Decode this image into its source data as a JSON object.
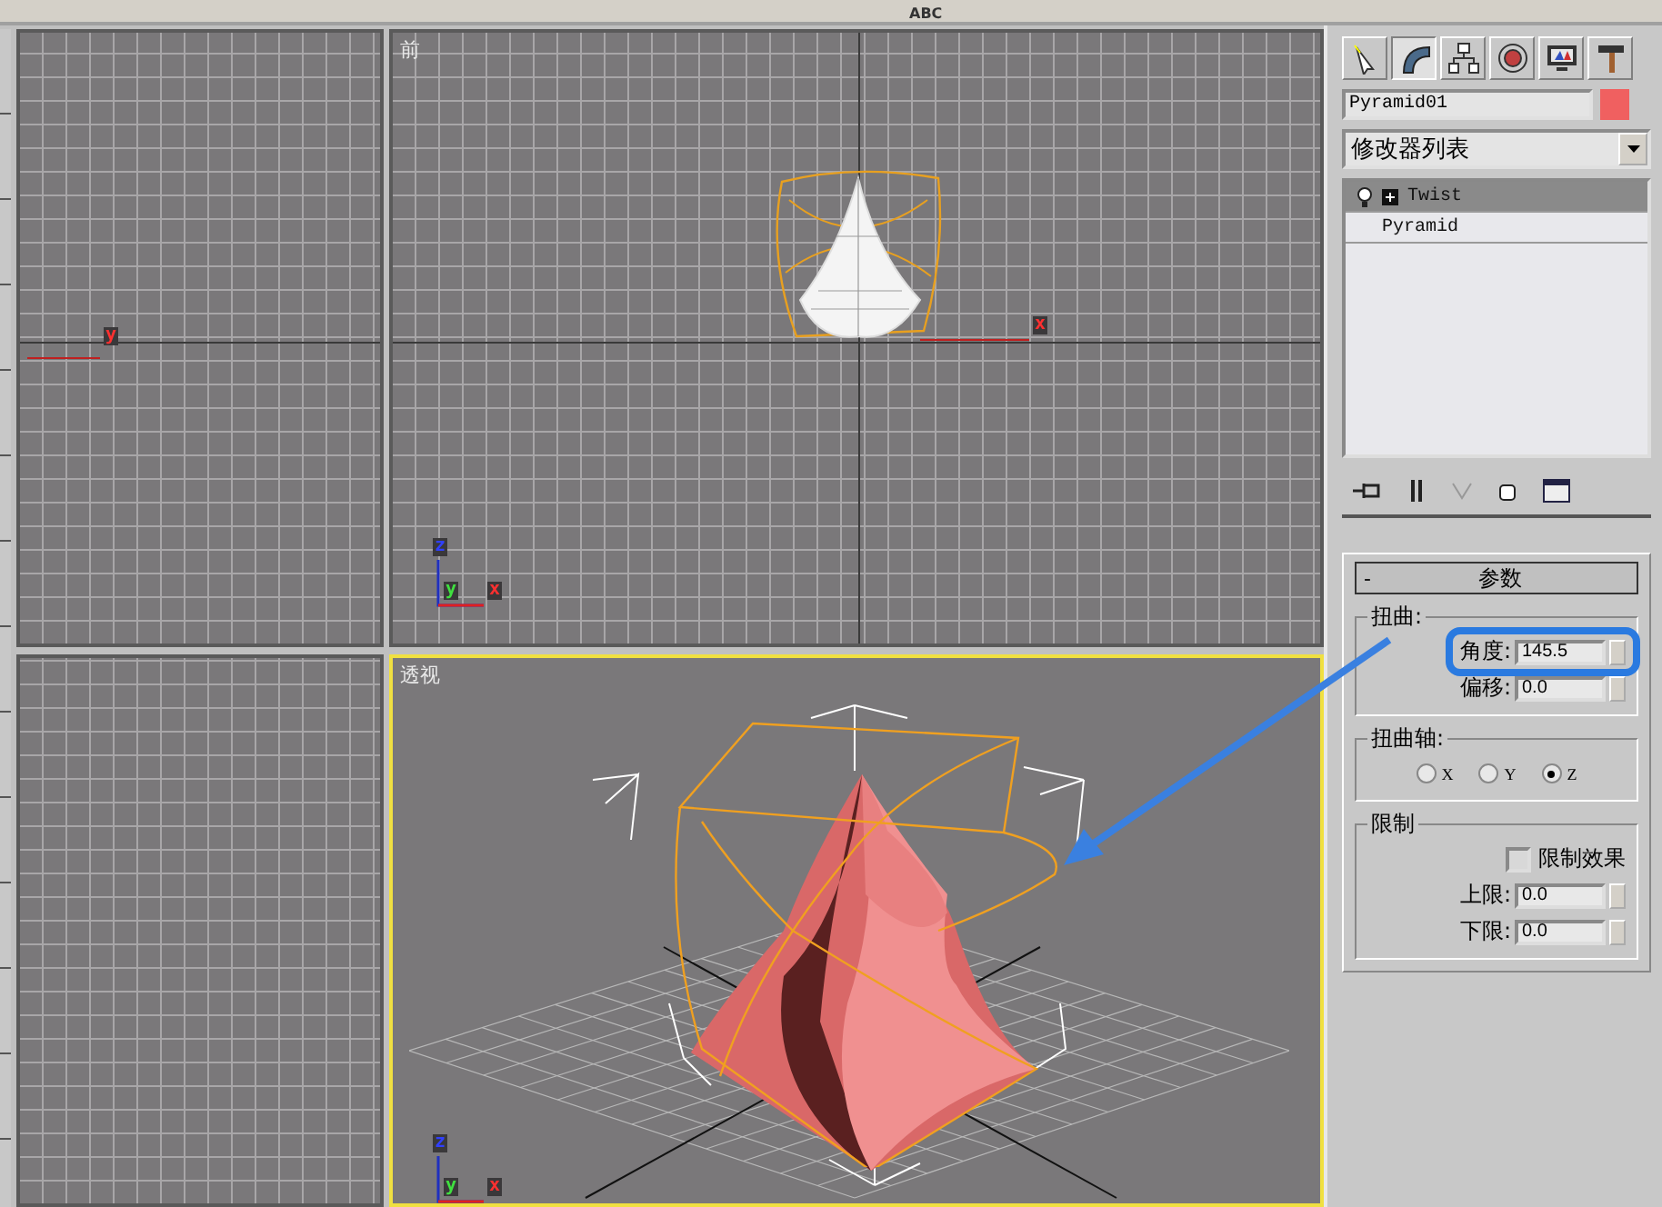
{
  "toolbar": {
    "text": "ABC"
  },
  "viewports": [
    {
      "kind": "top",
      "active": false,
      "axis_label": "y"
    },
    {
      "kind": "front",
      "title": "前",
      "active": false,
      "axis_label": "x",
      "tripod": [
        "z",
        "y",
        "x"
      ]
    },
    {
      "kind": "left",
      "active": false
    },
    {
      "kind": "perspective",
      "title": "透视",
      "active": true,
      "tripod": [
        "z",
        "y",
        "x"
      ]
    }
  ],
  "command_tabs": [
    {
      "kind": "create",
      "selected": false
    },
    {
      "kind": "modify",
      "selected": true
    },
    {
      "kind": "hierarchy",
      "selected": false
    },
    {
      "kind": "motion",
      "selected": false
    },
    {
      "kind": "display",
      "selected": false
    },
    {
      "kind": "utilities",
      "selected": false
    }
  ],
  "object_name": "Pyramid01",
  "modifier_list": "修改器列表",
  "stack": [
    {
      "kind": "modifier",
      "label": "Twist",
      "selected": true
    },
    {
      "kind": "base",
      "label": "Pyramid",
      "selected": false
    }
  ],
  "rollout": {
    "collapse": "-",
    "title": "参数",
    "twist": {
      "title": "扭曲:",
      "fields": [
        {
          "label": "角度:",
          "value": "145.5",
          "highlighted": true
        },
        {
          "label": "偏移:",
          "value": "0.0",
          "highlighted": false
        }
      ]
    },
    "axis": {
      "title": "扭曲轴:",
      "options": [
        {
          "label": "X",
          "selected": false
        },
        {
          "label": "Y",
          "selected": false
        },
        {
          "label": "Z",
          "selected": true
        }
      ]
    },
    "limits": {
      "title": "限制",
      "checkbox": {
        "label": "限制效果",
        "checked": false
      },
      "fields": [
        {
          "label": "上限:",
          "value": "0.0"
        },
        {
          "label": "下限:",
          "value": "0.0"
        }
      ]
    }
  }
}
